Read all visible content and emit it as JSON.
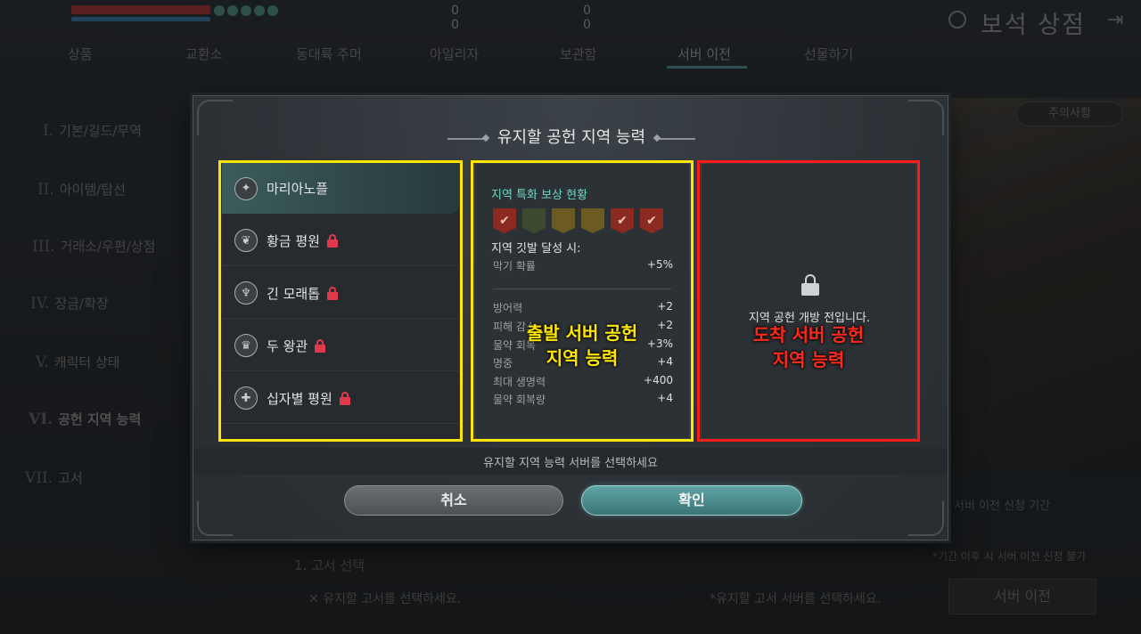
{
  "header": {
    "hp_value": "0",
    "mp_value": "0",
    "gold_value": "0",
    "gem_value": "0",
    "shop_title": "보석 상점"
  },
  "tabs": [
    {
      "label": "상품"
    },
    {
      "label": "교환소"
    },
    {
      "label": "동대륙 주머"
    },
    {
      "label": "아일리자"
    },
    {
      "label": "보관함"
    },
    {
      "label": "서버 이전",
      "active": true
    },
    {
      "label": "선물하기"
    }
  ],
  "nav": [
    {
      "num": "I.",
      "label": "기본/길드/무역"
    },
    {
      "num": "II.",
      "label": "아이템/탑선"
    },
    {
      "num": "III.",
      "label": "거래소/우편/상점"
    },
    {
      "num": "IV.",
      "label": "장금/확장"
    },
    {
      "num": "V.",
      "label": "캐릭터 상태"
    },
    {
      "num": "VI.",
      "label": "공헌 지역 능력",
      "active": true
    },
    {
      "num": "VII.",
      "label": "고서"
    }
  ],
  "notice_button": "주의사항",
  "background": {
    "step_label": "1. 고서 선택",
    "select_book": "유지할 고서를 선택하세요.",
    "select_server": "*유지할 고서 서버를 선택하세요.",
    "transfer_period": "서버 이전 신청 기간",
    "transfer_warning": "*기간 이후 시 서버 이전 신청 불가",
    "transfer_button": "서버 이전"
  },
  "modal": {
    "title": "유지할 공헌 지역 능력",
    "regions": [
      {
        "label": "마리아노플",
        "locked": false,
        "active": true
      },
      {
        "label": "황금 평원",
        "locked": true
      },
      {
        "label": "긴 모래톱",
        "locked": true
      },
      {
        "label": "두 왕관",
        "locked": true
      },
      {
        "label": "십자별 평원",
        "locked": true
      }
    ],
    "stats": {
      "heading": "지역 특화 보상 현황",
      "flags": [
        "red",
        "green",
        "gold",
        "gold",
        "red",
        "red"
      ],
      "condition_label": "지역 깃발 달성 시:",
      "first": {
        "name": "막기 확률",
        "value": "+5%"
      },
      "rows": [
        {
          "name": "방어력",
          "value": "+2"
        },
        {
          "name": "피해 감소",
          "value": "+2"
        },
        {
          "name": "물약 회복",
          "value": "+3%"
        },
        {
          "name": "명중",
          "value": "+4"
        },
        {
          "name": "최대 생명력",
          "value": "+400"
        },
        {
          "name": "물약 회복량",
          "value": "+4"
        }
      ]
    },
    "locked_text": "지역 공헌 개방 전입니다.",
    "prompt": "유지할 지역 능력 서버를 선택하세요",
    "cancel_label": "취소",
    "confirm_label": "확인"
  },
  "annotations": {
    "origin_line1": "출발 서버 공헌",
    "origin_line2": "지역 능력",
    "dest_line1": "도착 서버 공헌",
    "dest_line2": "지역 능력"
  }
}
